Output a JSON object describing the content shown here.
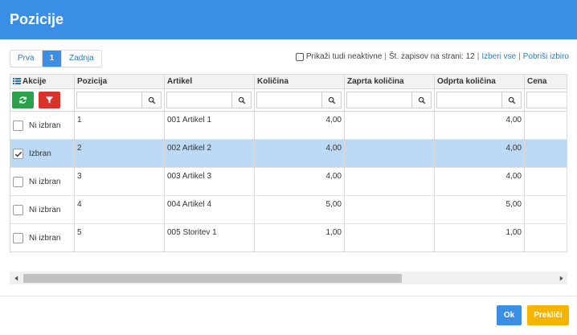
{
  "dialog": {
    "title": "Pozicije"
  },
  "pager": {
    "first": "Prva",
    "current": "1",
    "last": "Zadnja"
  },
  "options": {
    "show_inactive_label": "Prikaži tudi neaktivne",
    "per_page_label": "Št. zapisov na strani: 12",
    "select_all": "Izberi vse",
    "clear_selection": "Pobriši izbiro",
    "separator": "|"
  },
  "columns": {
    "akcije": "Akcije",
    "pozicija": "Pozicija",
    "artikel": "Artikel",
    "kolicina": "Količina",
    "zaprta": "Zaprta količina",
    "odprta": "Odprta količina",
    "cena": "Cena"
  },
  "rows": [
    {
      "state": "Ni izbran",
      "checked": false,
      "pozicija": "1",
      "artikel": "001 Artikel 1",
      "kolicina": "4,00",
      "zaprta": "",
      "odprta": "4,00",
      "cena": ""
    },
    {
      "state": "Izbran",
      "checked": true,
      "pozicija": "2",
      "artikel": "002 Artikel 2",
      "kolicina": "4,00",
      "zaprta": "",
      "odprta": "4,00",
      "cena": ""
    },
    {
      "state": "Ni izbran",
      "checked": false,
      "pozicija": "3",
      "artikel": "003 Artikel 3",
      "kolicina": "4,00",
      "zaprta": "",
      "odprta": "4,00",
      "cena": ""
    },
    {
      "state": "Ni izbran",
      "checked": false,
      "pozicija": "4",
      "artikel": "004 Artikel 4",
      "kolicina": "5,00",
      "zaprta": "",
      "odprta": "5,00",
      "cena": ""
    },
    {
      "state": "Ni izbran",
      "checked": false,
      "pozicija": "5",
      "artikel": "005 Storitev 1",
      "kolicina": "1,00",
      "zaprta": "",
      "odprta": "1,00",
      "cena": ""
    }
  ],
  "footer": {
    "ok": "Ok",
    "cancel": "Prekliči"
  },
  "colors": {
    "primary": "#3a8ee6",
    "selected_row": "#bcdaf6",
    "refresh": "#2aa14a",
    "filter": "#d9322c",
    "cancel": "#f4b400"
  },
  "icons": {
    "header": "list-icon",
    "refresh": "refresh-icon",
    "filter": "filter-icon",
    "search": "search-icon",
    "check": "check-icon"
  }
}
